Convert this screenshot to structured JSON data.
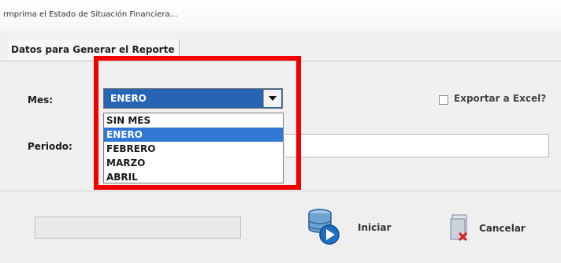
{
  "window": {
    "title": "rmprima el Estado de Situación Financiera..."
  },
  "tabs": [
    {
      "label": "Datos para Generar el Reporte"
    }
  ],
  "form": {
    "mes_label": "Mes:",
    "mes_selected": "ENERO",
    "mes_options": [
      "SIN MES",
      "ENERO",
      "FEBRERO",
      "MARZO",
      "ABRIL"
    ],
    "periodo_label": "Periodo:",
    "export_label": "Exportar a Excel?",
    "export_checked": false
  },
  "footer": {
    "progress": 0,
    "start_label": "Iniciar",
    "cancel_label": "Cancelar",
    "start_icon": "database-play-icon",
    "cancel_icon": "cancel-document-icon"
  },
  "colors": {
    "highlight": "#f20000",
    "selection": "#3178d6",
    "combo": "#2864b4"
  }
}
